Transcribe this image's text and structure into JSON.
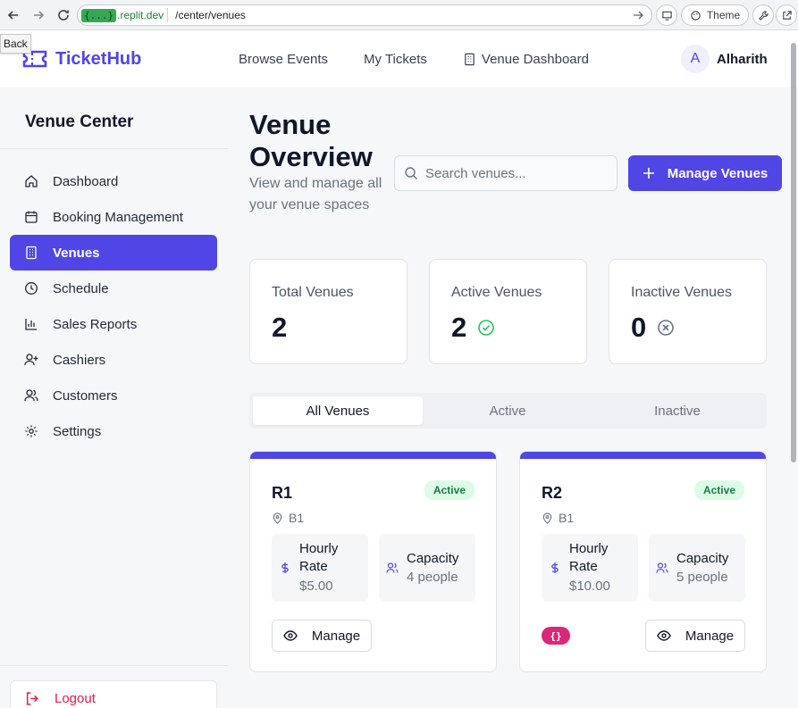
{
  "browser": {
    "url_badge": "{...}",
    "url_host": ".replit.dev",
    "url_path": "/center/venues",
    "theme_label": "Theme",
    "tooltip": "Back"
  },
  "header": {
    "brand": "TicketHub",
    "nav": [
      "Browse Events",
      "My Tickets",
      "Venue Dashboard"
    ],
    "user_initial": "A",
    "user_name": "Alharith"
  },
  "sidebar": {
    "title": "Venue Center",
    "items": [
      {
        "label": "Dashboard",
        "icon": "home-icon"
      },
      {
        "label": "Booking Management",
        "icon": "calendar-icon"
      },
      {
        "label": "Venues",
        "icon": "building-icon",
        "active": true
      },
      {
        "label": "Schedule",
        "icon": "clock-icon"
      },
      {
        "label": "Sales Reports",
        "icon": "bar-chart-icon"
      },
      {
        "label": "Cashiers",
        "icon": "user-plus-icon"
      },
      {
        "label": "Customers",
        "icon": "users-icon"
      },
      {
        "label": "Settings",
        "icon": "gear-icon"
      }
    ],
    "logout": "Logout"
  },
  "main": {
    "title": "Venue Overview",
    "subtitle": "View and manage all your venue spaces",
    "search_placeholder": "Search venues...",
    "manage_button": "Manage Venues",
    "stats": [
      {
        "label": "Total Venues",
        "value": "2"
      },
      {
        "label": "Active Venues",
        "value": "2"
      },
      {
        "label": "Inactive Venues",
        "value": "0"
      }
    ],
    "tabs": [
      "All Venues",
      "Active",
      "Inactive"
    ],
    "venues": [
      {
        "name": "R1",
        "status": "Active",
        "location": "B1",
        "rate_label": "Hourly Rate",
        "rate": "$5.00",
        "capacity_label": "Capacity",
        "capacity": "4 people",
        "manage": "Manage"
      },
      {
        "name": "R2",
        "status": "Active",
        "location": "B1",
        "rate_label": "Hourly Rate",
        "rate": "$10.00",
        "capacity_label": "Capacity",
        "capacity": "5 people",
        "manage": "Manage",
        "dev_badge": "{}"
      }
    ]
  },
  "colors": {
    "accent": "#4f46e5",
    "active_badge_bg": "#dcfce7",
    "active_badge_text": "#15803d",
    "logout": "#e11d48"
  }
}
